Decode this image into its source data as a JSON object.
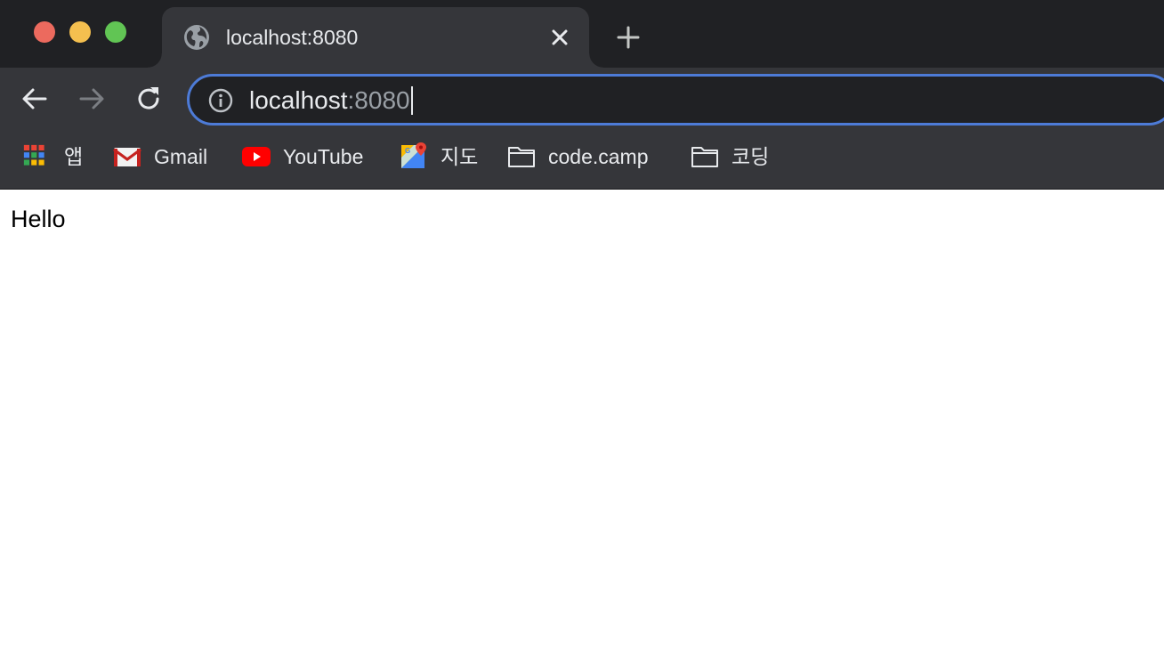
{
  "window": {
    "controls": [
      "close",
      "minimize",
      "maximize"
    ]
  },
  "tab": {
    "title": "localhost:8080",
    "favicon": "globe-icon",
    "close_icon": "close-icon"
  },
  "new_tab_icon": "plus-icon",
  "toolbar": {
    "back_icon": "arrow-left-icon",
    "forward_icon": "arrow-right-icon",
    "reload_icon": "reload-icon"
  },
  "omnibox": {
    "info_icon": "info-icon",
    "host": "localhost",
    "port": ":8080",
    "border_color": "#4d7bd7"
  },
  "bookmarks": [
    {
      "label": "앱",
      "icon": "apps-grid-icon"
    },
    {
      "label": "Gmail",
      "icon": "gmail-icon"
    },
    {
      "label": "YouTube",
      "icon": "youtube-icon"
    },
    {
      "label": "지도",
      "icon": "maps-icon"
    },
    {
      "label": "code.camp",
      "icon": "folder-icon"
    },
    {
      "label": "코딩",
      "icon": "folder-icon"
    }
  ],
  "page": {
    "text": "Hello"
  }
}
